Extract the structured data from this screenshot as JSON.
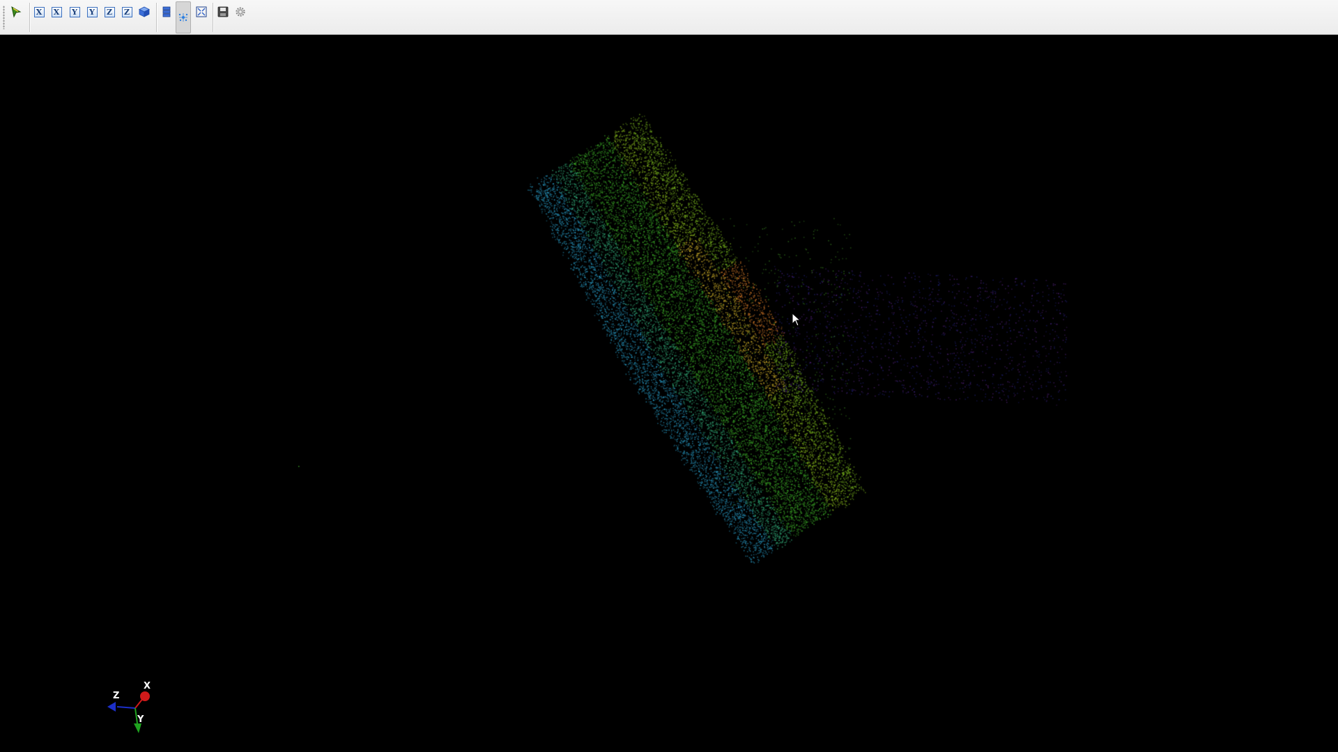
{
  "toolbar": {
    "buttons": [
      {
        "name": "select-pointer-icon"
      },
      {
        "name": "view-pos-x-icon",
        "label": "X"
      },
      {
        "name": "view-neg-x-icon",
        "label": "X"
      },
      {
        "name": "view-pos-y-icon",
        "label": "Y"
      },
      {
        "name": "view-neg-y-icon",
        "label": "Y"
      },
      {
        "name": "view-pos-z-icon",
        "label": "Z"
      },
      {
        "name": "view-neg-z-icon",
        "label": "Z"
      },
      {
        "name": "iso-view-cube-icon"
      },
      {
        "name": "layers-icon"
      },
      {
        "name": "pick-points-icon",
        "pressed": true
      },
      {
        "name": "fit-to-screen-icon"
      },
      {
        "name": "save-icon"
      },
      {
        "name": "settings-gear-icon"
      }
    ]
  },
  "axes_widget": {
    "x_label": "X",
    "y_label": "Y",
    "z_label": "Z",
    "x_color": "#d11a1a",
    "y_color": "#1fa31f",
    "z_color": "#1c2fc9"
  },
  "viewport": {
    "background": "#000000"
  }
}
